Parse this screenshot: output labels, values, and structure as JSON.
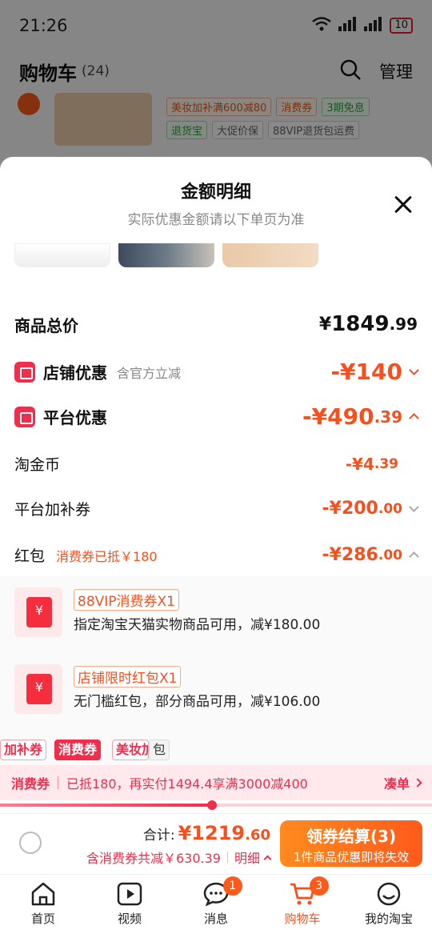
{
  "status_bar": {
    "time": "21:26",
    "wifi": "6",
    "battery": "10"
  },
  "cart": {
    "title": "购物车",
    "count": "(24)",
    "manage": "管理"
  },
  "bg_item": {
    "tags": [
      {
        "text": "美妆加补满600减80",
        "style": "orange"
      },
      {
        "text": "消费券",
        "style": "orange"
      },
      {
        "text": "3期免息",
        "style": "green"
      },
      {
        "text": "退货宝",
        "style": "green"
      },
      {
        "text": "大促价保",
        "style": "gray"
      },
      {
        "text": "88VIP退货包运费",
        "style": "gray"
      }
    ]
  },
  "sheet": {
    "title": "金额明细",
    "subtitle": "实际优惠金额请以下单页为准",
    "goods_total": {
      "label": "商品总价",
      "currency": "¥",
      "int": "1849",
      "dec": ".99"
    },
    "shop_discount": {
      "label": "店铺优惠",
      "hint": "含官方立减",
      "value": "-¥140"
    },
    "platform_discount": {
      "label": "平台优惠",
      "int": "-¥490",
      "dec": ".39"
    },
    "taojinbi": {
      "label": "淘金币",
      "int": "-¥4",
      "dec": ".39"
    },
    "platform_coupon": {
      "label": "平台加补券",
      "int": "-¥200",
      "dec": ".00"
    },
    "red_packet": {
      "label": "红包",
      "hint": "消费券已抵￥180",
      "int": "-¥286",
      "dec": ".00"
    },
    "coupons": [
      {
        "tag": "88VIP消费券X1",
        "desc": "指定淘宝天猫实物商品可用，减¥180.00"
      },
      {
        "tag": "店铺限时红包X1",
        "desc": "无门槛红包，部分商品可用，减¥106.00"
      }
    ],
    "strip_tags": [
      "加补券",
      "消费券",
      "美妆加",
      "包"
    ],
    "promo": {
      "key": "消费券",
      "text": "已抵180，再实付1494.4享满3000减400",
      "link": "凑单"
    },
    "progress": 0.49
  },
  "checkout": {
    "total_label": "合计:",
    "total_int": "¥1219",
    "total_dec": ".60",
    "save_text": "含消费券共减￥630.39",
    "detail_label": "明细",
    "button_main": "领券结算(3)",
    "button_sub": "1件商品优惠即将失效"
  },
  "tabbar": [
    {
      "label": "首页",
      "icon": "home-icon"
    },
    {
      "label": "视频",
      "icon": "video-icon"
    },
    {
      "label": "消息",
      "icon": "message-icon",
      "badge": "1"
    },
    {
      "label": "购物车",
      "icon": "cart-icon",
      "badge": "3",
      "active": true
    },
    {
      "label": "我的淘宝",
      "icon": "profile-icon"
    }
  ],
  "colors": {
    "accent": "#f5501e",
    "red": "#f02d4b"
  }
}
